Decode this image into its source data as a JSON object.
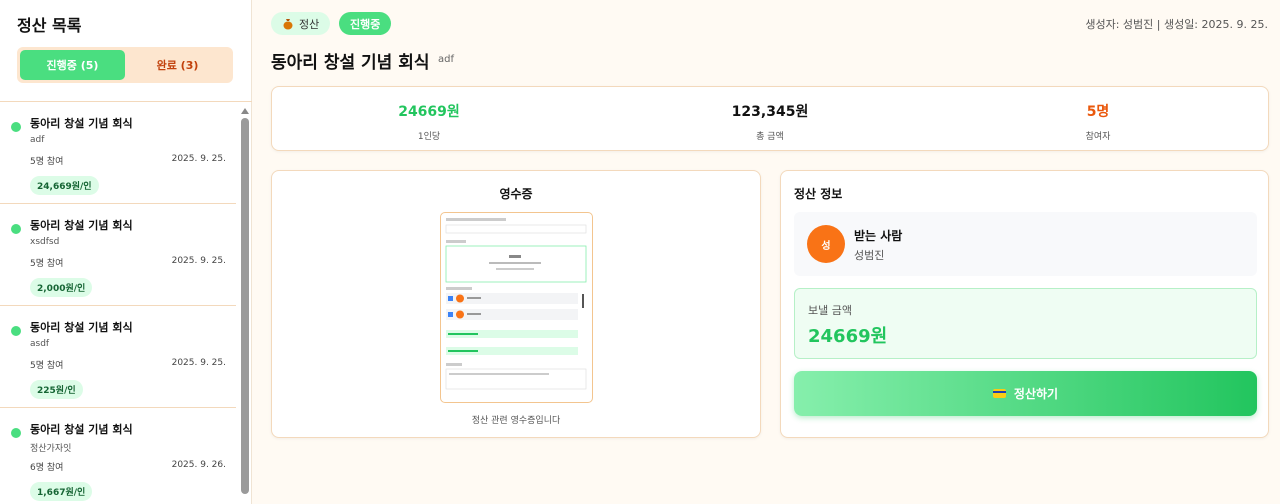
{
  "sidebar": {
    "title": "정산 목록",
    "tabs": [
      {
        "label": "진행중 (5)",
        "active": true
      },
      {
        "label": "완료 (3)",
        "active": false
      }
    ],
    "items": [
      {
        "title": "동아리 창설 기념 회식",
        "desc": "adf",
        "participants": "5명 참여",
        "date": "2025. 9. 25.",
        "per_person": "24,669원/인"
      },
      {
        "title": "동아리 창설 기념 회식",
        "desc": "xsdfsd",
        "participants": "5명 참여",
        "date": "2025. 9. 25.",
        "per_person": "2,000원/인"
      },
      {
        "title": "동아리 창설 기념 회식",
        "desc": "asdf",
        "participants": "5명 참여",
        "date": "2025. 9. 25.",
        "per_person": "225원/인"
      },
      {
        "title": "동아리 창설 기념 회식",
        "desc": "정산가자잇",
        "participants": "6명 참여",
        "date": "2025. 9. 26.",
        "per_person": "1,667원/인"
      }
    ]
  },
  "header": {
    "category_icon": "money-bag-icon",
    "category": "정산",
    "status": "진행중",
    "meta": "생성자: 성범진 | 생성일: 2025. 9. 25.",
    "title": "동아리 창설 기념 회식",
    "subtitle": "adf"
  },
  "stats": [
    {
      "value": "24669원",
      "label": "1인당",
      "color": "#22c55e"
    },
    {
      "value": "123,345원",
      "label": "총 금액",
      "color": "#111111"
    },
    {
      "value": "5명",
      "label": "참여자",
      "color": "#ea580c"
    }
  ],
  "receipt": {
    "title": "영수증",
    "caption": "정산 관련 영수증입니다"
  },
  "settlement_info": {
    "title": "정산 정보",
    "avatar_initial": "성",
    "receiver_label": "받는 사람",
    "receiver_name": "성범진",
    "amount_label": "보낼 금액",
    "amount_value": "24669원",
    "button_icon": "credit-card-icon",
    "button_label": "정산하기"
  },
  "colors": {
    "accent": "#22c55e",
    "accent_light": "#4ade80",
    "orange": "#f97316"
  }
}
